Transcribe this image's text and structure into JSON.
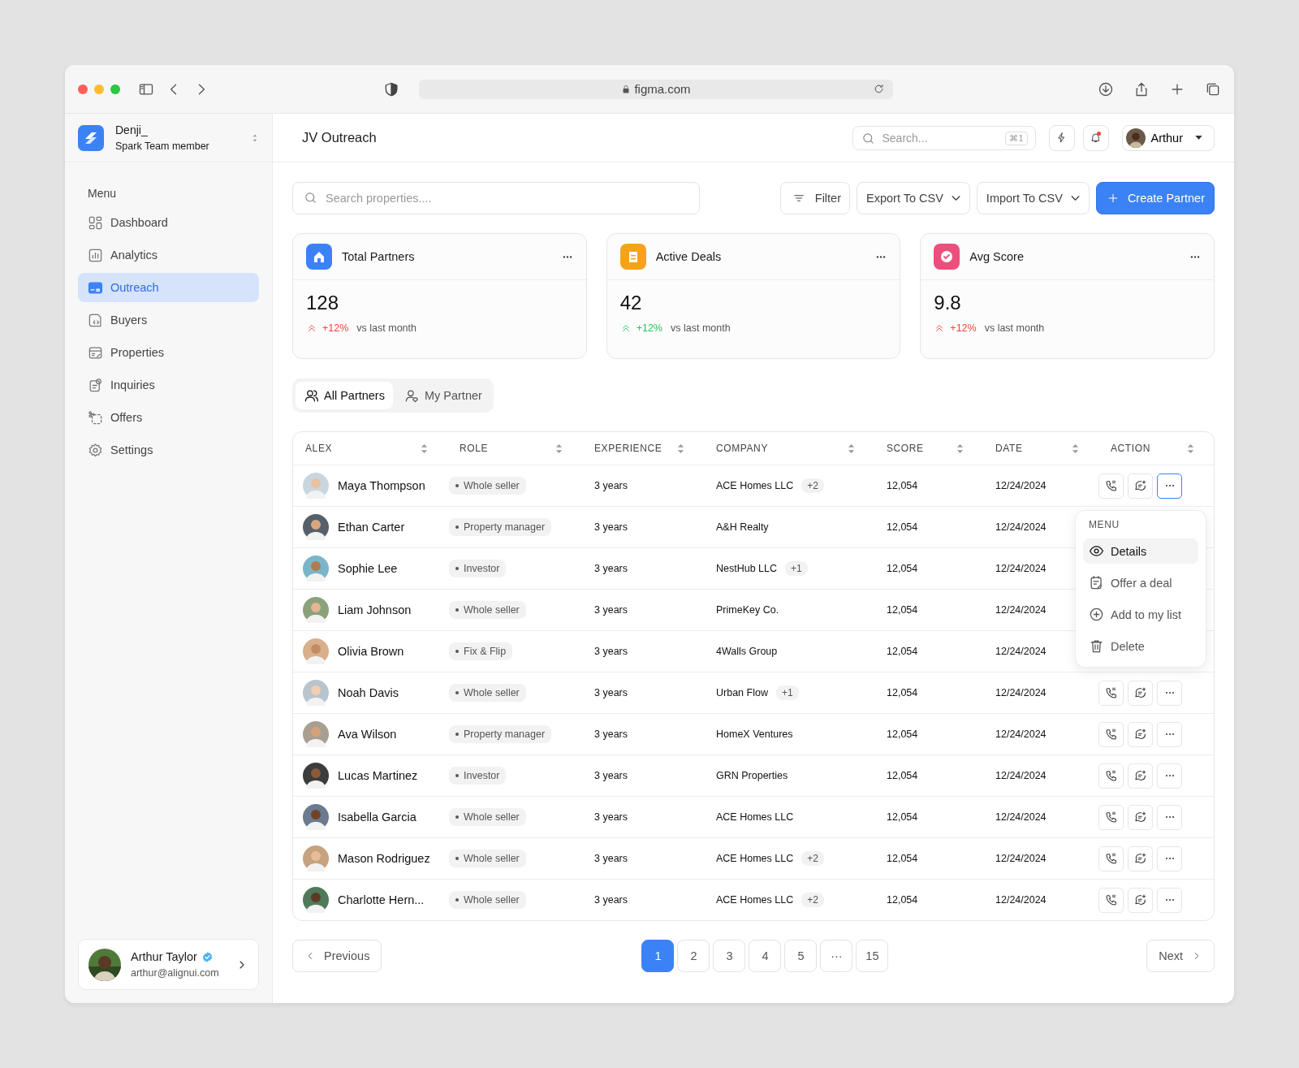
{
  "browser": {
    "url": "figma.com"
  },
  "workspace": {
    "name": "Denji_",
    "role": "Spark Team member"
  },
  "sidebar": {
    "heading": "Menu",
    "items": [
      {
        "label": "Dashboard",
        "selected": false
      },
      {
        "label": "Analytics",
        "selected": false
      },
      {
        "label": "Outreach",
        "selected": true
      },
      {
        "label": "Buyers",
        "selected": false
      },
      {
        "label": "Properties",
        "selected": false
      },
      {
        "label": "Inquiries",
        "selected": false
      },
      {
        "label": "Offers",
        "selected": false
      },
      {
        "label": "Settings",
        "selected": false
      }
    ]
  },
  "user": {
    "name": "Arthur Taylor",
    "email": "arthur@alignui.com",
    "verified": true
  },
  "header": {
    "title": "JV Outreach",
    "search": {
      "placeholder": "Search...",
      "shortcut": "⌘1"
    },
    "notifications_unread": true,
    "account": "Arthur"
  },
  "toolbar": {
    "search": {
      "placeholder": "Search properties...."
    },
    "buttons": [
      {
        "label": "Filter",
        "kind": "filter"
      },
      {
        "label": "Export To CSV",
        "kind": "dropdown"
      },
      {
        "label": "Import To CSV",
        "kind": "dropdown"
      },
      {
        "label": "Create Partner",
        "kind": "primary"
      }
    ]
  },
  "stats": [
    {
      "title": "Total Partners",
      "value": "128",
      "change": {
        "text": "+12%",
        "color": "#f04438"
      },
      "note": "vs last month",
      "color": "#3b82f6"
    },
    {
      "title": "Active Deals",
      "value": "42",
      "change": {
        "text": "+12%",
        "color": "#22c55e"
      },
      "note": "vs last month",
      "color": "#f7a21b"
    },
    {
      "title": "Avg Score",
      "value": "9.8",
      "change": {
        "text": "+12%",
        "color": "#f04438"
      },
      "note": "vs last month",
      "color": "#ec4f7c"
    }
  ],
  "tabs": [
    {
      "label": "All Partners",
      "selected": true
    },
    {
      "label": "My Partner",
      "selected": false
    }
  ],
  "table": {
    "columns": [
      "ALEX",
      "ROLE",
      "EXPERIENCE",
      "COMPANY",
      "SCORE",
      "DATE",
      "ACTION"
    ],
    "rows": [
      {
        "name": "Maya Thompson",
        "role": "Whole seller",
        "experience": "3 years",
        "company": "ACE Homes LLC",
        "extra": "+2",
        "score": "12,054",
        "date": "12/24/2024"
      },
      {
        "name": "Ethan Carter",
        "role": "Property manager",
        "experience": "3 years",
        "company": "A&H Realty",
        "score": "12,054",
        "date": "12/24/2024"
      },
      {
        "name": "Sophie Lee",
        "role": "Investor",
        "experience": "3 years",
        "company": "NestHub LLC",
        "extra": "+1",
        "score": "12,054",
        "date": "12/24/2024"
      },
      {
        "name": "Liam Johnson",
        "role": "Whole seller",
        "experience": "3 years",
        "company": "PrimeKey Co.",
        "score": "12,054",
        "date": "12/24/2024"
      },
      {
        "name": "Olivia Brown",
        "role": "Fix & Flip",
        "experience": "3 years",
        "company": "4Walls Group",
        "score": "12,054",
        "date": "12/24/2024"
      },
      {
        "name": "Noah Davis",
        "role": "Whole seller",
        "experience": "3 years",
        "company": "Urban Flow",
        "extra": "+1",
        "score": "12,054",
        "date": "12/24/2024"
      },
      {
        "name": "Ava Wilson",
        "role": "Property manager",
        "experience": "3 years",
        "company": "HomeX Ventures",
        "score": "12,054",
        "date": "12/24/2024"
      },
      {
        "name": "Lucas Martinez",
        "role": "Investor",
        "experience": "3 years",
        "company": "GRN Properties",
        "score": "12,054",
        "date": "12/24/2024"
      },
      {
        "name": "Isabella Garcia",
        "role": "Whole seller",
        "experience": "3 years",
        "company": "ACE Homes LLC",
        "score": "12,054",
        "date": "12/24/2024"
      },
      {
        "name": "Mason Rodriguez",
        "role": "Whole seller",
        "experience": "3 years",
        "company": "ACE Homes LLC",
        "extra": "+2",
        "score": "12,054",
        "date": "12/24/2024"
      },
      {
        "name": "Charlotte Hern...",
        "role": "Whole seller",
        "experience": "3 years",
        "company": "ACE Homes LLC",
        "extra": "+2",
        "score": "12,054",
        "date": "12/24/2024"
      }
    ]
  },
  "row_menu": {
    "open": true,
    "title": "MENU",
    "items": [
      {
        "label": "Details",
        "selected": true
      },
      {
        "label": "Offer a deal",
        "selected": false
      },
      {
        "label": "Add to my list",
        "selected": false
      },
      {
        "label": "Delete",
        "selected": false
      }
    ]
  },
  "pagination": {
    "previous": "Previous",
    "next": "Next",
    "pages": [
      {
        "label": "1",
        "selected": true
      },
      {
        "label": "2",
        "selected": false
      },
      {
        "label": "3",
        "selected": false
      },
      {
        "label": "4",
        "selected": false
      },
      {
        "label": "5",
        "selected": false
      },
      {
        "label": "···",
        "selected": false
      },
      {
        "label": "15",
        "selected": false
      }
    ]
  }
}
